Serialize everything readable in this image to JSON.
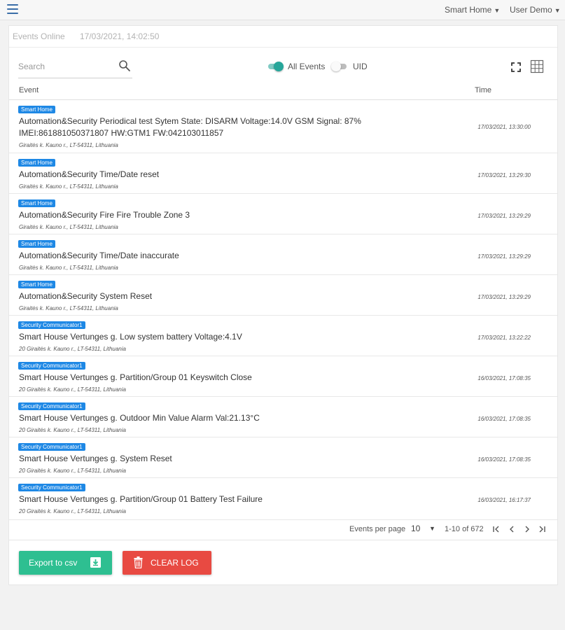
{
  "header": {
    "menu_items": [
      {
        "label": "Smart Home"
      },
      {
        "label": "User Demo"
      }
    ]
  },
  "panel": {
    "title": "Events Online",
    "timestamp": "17/03/2021, 14:02:50"
  },
  "filters": {
    "search_placeholder": "Search",
    "all_events_label": "All Events",
    "all_events_on": true,
    "uid_label": "UID",
    "uid_on": false
  },
  "table": {
    "columns": [
      "Event",
      "Time"
    ],
    "rows": [
      {
        "source": "Smart Home",
        "message": "Automation&Security Periodical test Sytem State: DISARM Voltage:14.0V GSM Signal: 87% IMEI:861881050371807 HW:GTM1 FW:042103011857",
        "location": "Giraitės k. Kauno r., LT-54311, Lithuania",
        "time": "17/03/2021, 13:30:00"
      },
      {
        "source": "Smart Home",
        "message": "Automation&Security Time/Date reset",
        "location": "Giraitės k. Kauno r., LT-54311, Lithuania",
        "time": "17/03/2021, 13:29:30"
      },
      {
        "source": "Smart Home",
        "message": "Automation&Security Fire Fire Trouble Zone 3",
        "location": "Giraitės k. Kauno r., LT-54311, Lithuania",
        "time": "17/03/2021, 13:29:29"
      },
      {
        "source": "Smart Home",
        "message": "Automation&Security Time/Date inaccurate",
        "location": "Giraitės k. Kauno r., LT-54311, Lithuania",
        "time": "17/03/2021, 13:29:29"
      },
      {
        "source": "Smart Home",
        "message": "Automation&Security System Reset",
        "location": "Giraitės k. Kauno r., LT-54311, Lithuania",
        "time": "17/03/2021, 13:29:29"
      },
      {
        "source": "Security Communicator1",
        "message": "Smart House Vertunges g. Low system battery Voltage:4.1V",
        "location": "20 Giraitės k. Kauno r., LT-54311, Lithuania",
        "time": "17/03/2021, 13:22:22"
      },
      {
        "source": "Security Communicator1",
        "message": "Smart House Vertunges g. Partition/Group 01 Keyswitch Close",
        "location": "20 Giraitės k. Kauno r., LT-54311, Lithuania",
        "time": "16/03/2021, 17:08:35"
      },
      {
        "source": "Security Communicator1",
        "message": "Smart House Vertunges g. Outdoor Min Value Alarm Val:21.13°C",
        "location": "20 Giraitės k. Kauno r., LT-54311, Lithuania",
        "time": "16/03/2021, 17:08:35"
      },
      {
        "source": "Security Communicator1",
        "message": "Smart House Vertunges g. System Reset",
        "location": "20 Giraitės k. Kauno r., LT-54311, Lithuania",
        "time": "16/03/2021, 17:08:35"
      },
      {
        "source": "Security Communicator1",
        "message": "Smart House Vertunges g. Partition/Group 01 Battery Test Failure",
        "location": "20 Giraitės k. Kauno r., LT-54311, Lithuania",
        "time": "16/03/2021, 16:17:37"
      }
    ]
  },
  "pagination": {
    "per_page_label": "Events per page",
    "per_page_value": "10",
    "range_text": "1-10 of 672"
  },
  "actions": {
    "export_label": "Export to csv",
    "clear_label": "CLEAR LOG"
  },
  "colors": {
    "smart_home_badge": "#1e88e5",
    "security_badge": "#1e88e5",
    "toggle_on": "#26a69a",
    "export_button": "#2ebf91",
    "clear_button": "#e84a42",
    "menu_icon": "#3b6ea8"
  },
  "icons": {
    "menu": "hamburger-icon",
    "search": "search-icon",
    "fullscreen": "fullscreen-icon",
    "grid": "grid-icon",
    "export": "download-icon",
    "clear": "trash-icon",
    "first_page": "first-page-icon",
    "prev_page": "prev-page-icon",
    "next_page": "next-page-icon",
    "last_page": "last-page-icon"
  }
}
